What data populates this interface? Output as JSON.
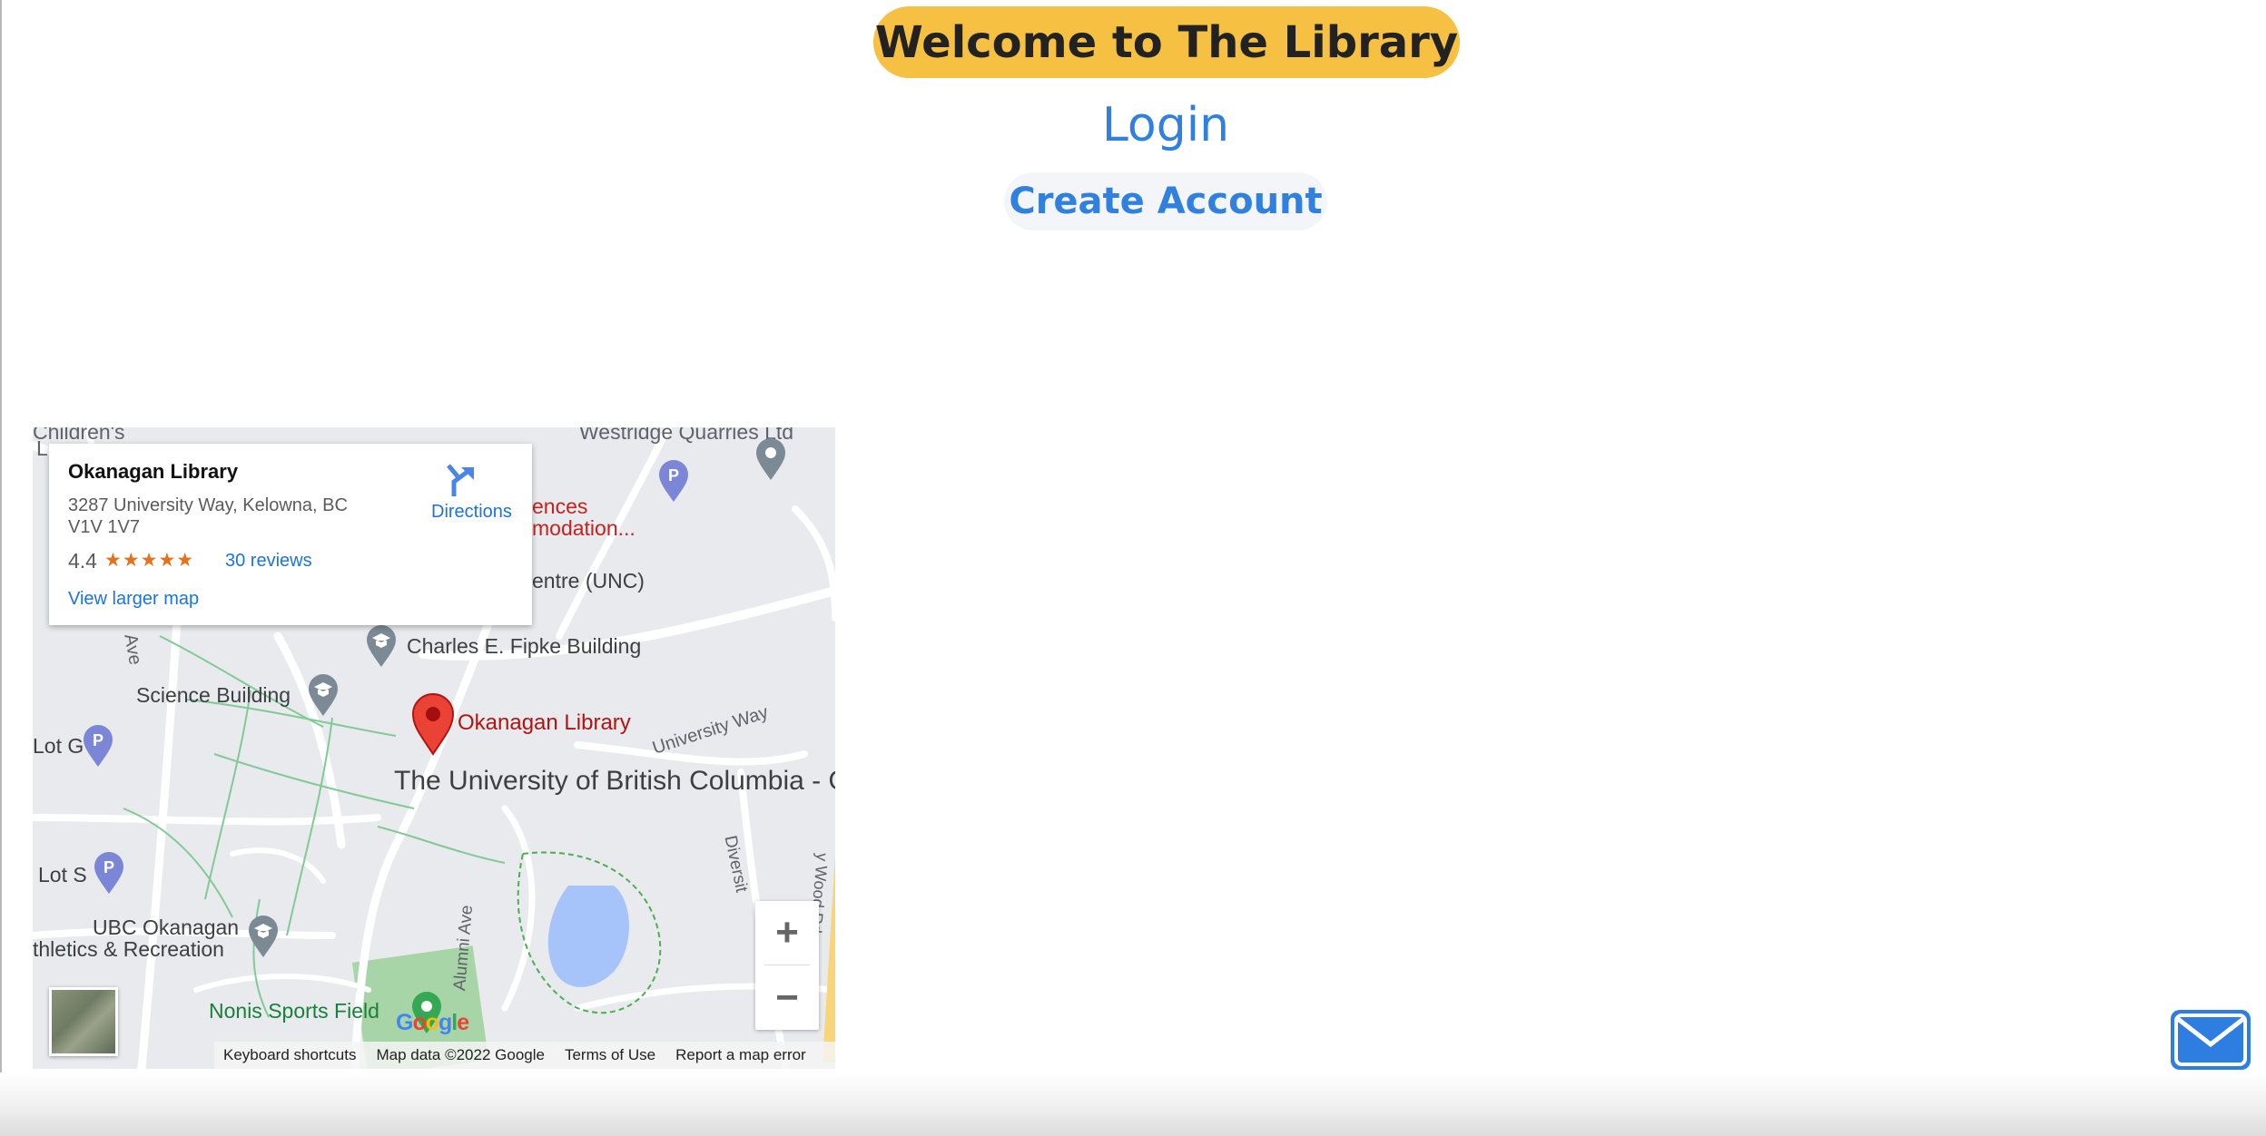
{
  "header": {
    "welcome_text": "Welcome to The Library",
    "login_label": "Login",
    "create_account_label": "Create Account"
  },
  "map": {
    "info_card": {
      "name": "Okanagan Library",
      "address": "3287 University Way, Kelowna, BC V1V 1V7",
      "rating": "4.4",
      "stars": "★★★★★",
      "reviews": "30 reviews",
      "view_larger": "View larger map",
      "directions": "Directions"
    },
    "labels": {
      "childrens": "Children's",
      "westridge": "Westridge Quarries Ltd",
      "sciences": "ences",
      "accommodation": "modation...",
      "unc": "entre (UNC)",
      "fipke": "Charles E. Fipke Building",
      "science_building": "Science Building",
      "okanagan_library": "Okanagan Library",
      "university_way": "University Way",
      "ubc": "The University of British Columbia - Okanagan...",
      "lot_g": "Lot G",
      "lot_s": "Lot S",
      "ubc_athletics_1": "UBC Okanagan",
      "ubc_athletics_2": "thletics & Recreation",
      "nonis": "Nonis Sports Field",
      "alumni_ave": "Alumni Ave",
      "diversity": "Diversit",
      "ave": "Ave",
      "wood_rd": "y Wood Rd",
      "l": "L"
    },
    "zoom_in": "+",
    "zoom_out": "−",
    "google": "Google",
    "footer": {
      "shortcuts": "Keyboard shortcuts",
      "map_data": "Map data ©2022 Google",
      "terms": "Terms of Use",
      "report": "Report a map error"
    }
  },
  "colors": {
    "welcome_bg": "#f6c143",
    "link_blue": "#2f80df",
    "map_bg": "#e8eaed",
    "pin_red": "#ea4335",
    "mail_blue": "#2d7ee0"
  },
  "icons": [
    "directions-icon",
    "parking-icon",
    "school-icon",
    "library-pin-icon",
    "mail-icon"
  ]
}
